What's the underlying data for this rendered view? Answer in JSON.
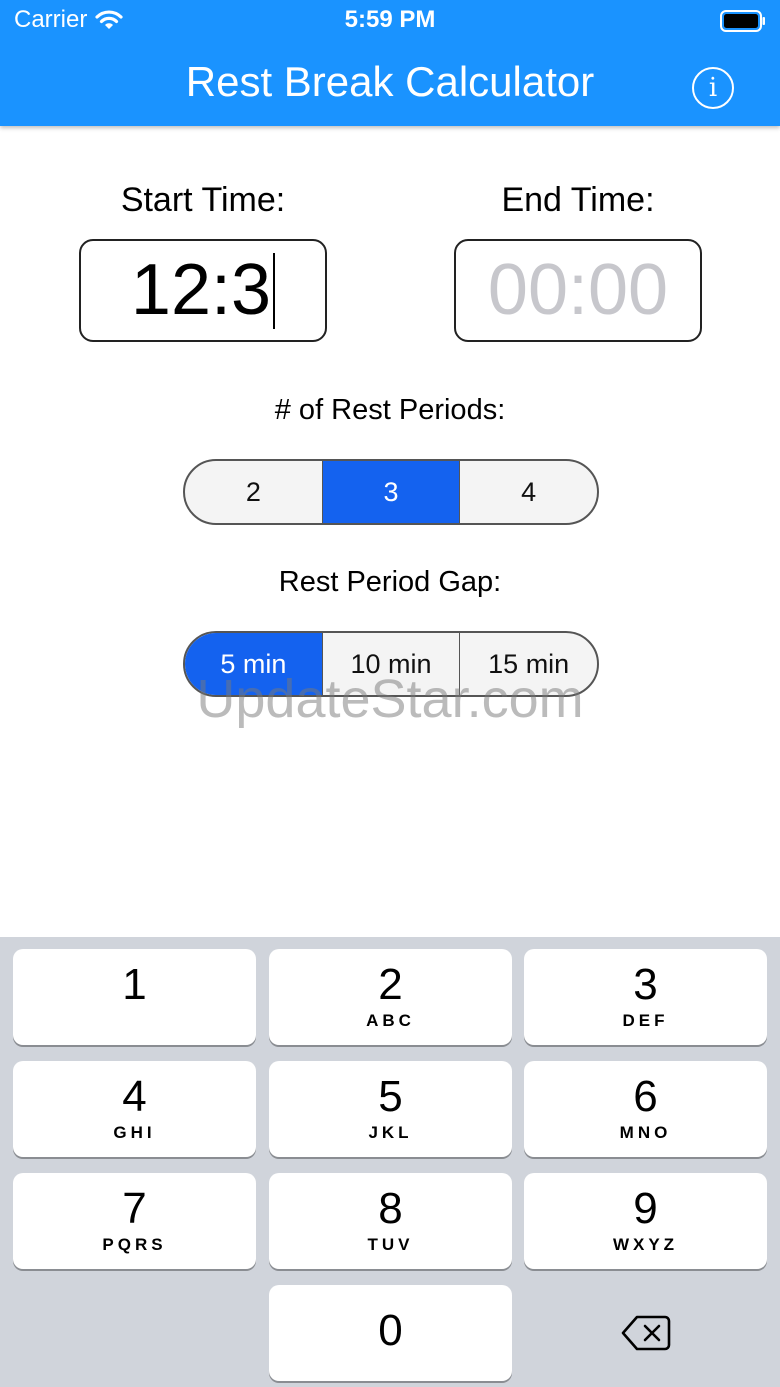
{
  "status_bar": {
    "carrier": "Carrier",
    "time": "5:59 PM"
  },
  "header": {
    "title": "Rest Break Calculator",
    "info_icon": "i"
  },
  "start_time": {
    "label": "Start Time:",
    "value": "12:3"
  },
  "end_time": {
    "label": "End Time:",
    "placeholder": "00:00"
  },
  "rest_periods": {
    "label": "# of Rest Periods:",
    "options": [
      "2",
      "3",
      "4"
    ],
    "selected": "3"
  },
  "rest_gap": {
    "label": "Rest Period Gap:",
    "options": [
      "5 min",
      "10 min",
      "15 min"
    ],
    "selected": "5 min"
  },
  "watermark": "UpdateStar.com",
  "keypad": {
    "keys": [
      {
        "digit": "1",
        "letters": ""
      },
      {
        "digit": "2",
        "letters": "ABC"
      },
      {
        "digit": "3",
        "letters": "DEF"
      },
      {
        "digit": "4",
        "letters": "GHI"
      },
      {
        "digit": "5",
        "letters": "JKL"
      },
      {
        "digit": "6",
        "letters": "MNO"
      },
      {
        "digit": "7",
        "letters": "PQRS"
      },
      {
        "digit": "8",
        "letters": "TUV"
      },
      {
        "digit": "9",
        "letters": "WXYZ"
      }
    ],
    "zero": "0",
    "delete_icon": "backspace-icon"
  },
  "colors": {
    "header": "#1a93ff",
    "selected_segment": "#1462ef",
    "keyboard_bg": "#d0d4db"
  }
}
